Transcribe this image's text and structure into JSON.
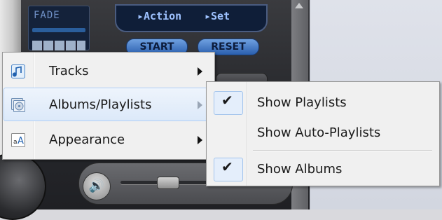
{
  "player": {
    "lcd_label": "FADE",
    "action_label": "▸Action",
    "set_label": "▸Set",
    "start_label": "START",
    "reset_label": "RESET",
    "volume_icon": "speaker-icon"
  },
  "context_menu": {
    "items": [
      {
        "label": "Tracks",
        "icon": "music-note-icon",
        "has_submenu": true
      },
      {
        "label": "Albums/Playlists",
        "icon": "album-disc-icon",
        "has_submenu": true,
        "highlighted": true
      },
      {
        "label": "Appearance",
        "icon": "font-appearance-icon",
        "has_submenu": true
      }
    ]
  },
  "submenu": {
    "items": [
      {
        "label": "Show Playlists",
        "checked": true,
        "check_glyph": "✔"
      },
      {
        "label": "Show Auto-Playlists",
        "checked": false
      },
      {
        "label": "Show Albums",
        "checked": true,
        "check_glyph": "✔"
      }
    ]
  },
  "colors": {
    "menu_bg": "#f0f0f0",
    "highlight_border": "#aecff7",
    "highlight_fill": "#dce9f9",
    "player_accent": "#2a5fae"
  }
}
